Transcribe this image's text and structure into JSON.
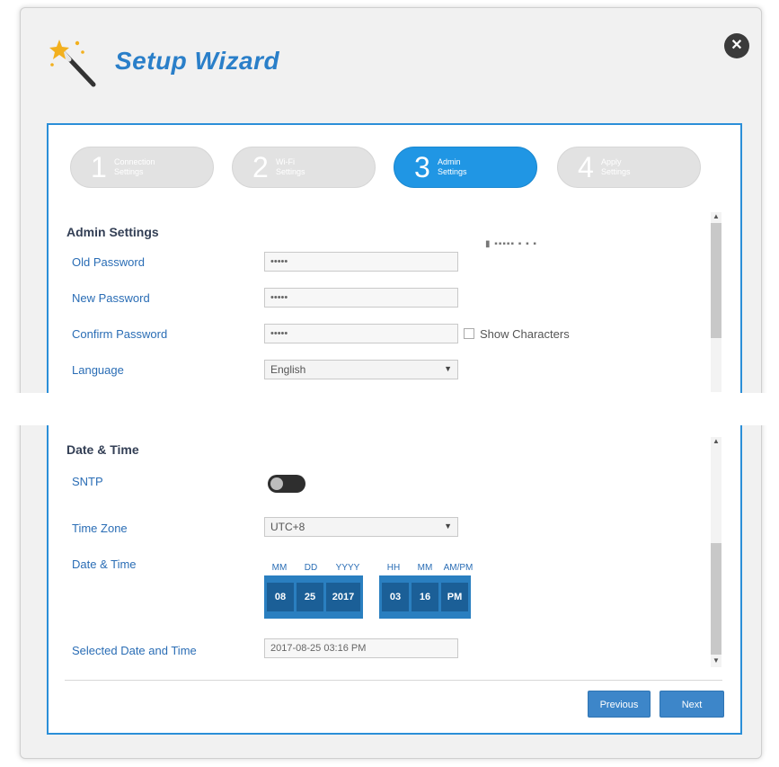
{
  "header": {
    "title": "Setup Wizard"
  },
  "steps": [
    {
      "num": "1",
      "label": "Connection\nSettings"
    },
    {
      "num": "2",
      "label": "Wi-Fi\nSettings"
    },
    {
      "num": "3",
      "label": "Admin\nSettings"
    },
    {
      "num": "4",
      "label": "Apply\nSettings"
    }
  ],
  "admin": {
    "section_title": "Admin Settings",
    "old_password_label": "Old Password",
    "old_password_value": "•••••",
    "new_password_label": "New Password",
    "new_password_value": "•••••",
    "confirm_password_label": "Confirm Password",
    "confirm_password_value": "•••••",
    "show_characters_label": "Show Characters",
    "language_label": "Language",
    "language_value": "English"
  },
  "datetime": {
    "section_title": "Date & Time",
    "sntp_label": "SNTP",
    "timezone_label": "Time Zone",
    "timezone_value": "UTC+8",
    "datetime_label": "Date & Time",
    "headers": [
      "MM",
      "DD",
      "YYYY",
      "HH",
      "MM",
      "AM/PM"
    ],
    "values": [
      "08",
      "25",
      "2017",
      "03",
      "16",
      "PM"
    ],
    "selected_label": "Selected Date and Time",
    "selected_value": "2017-08-25 03:16 PM"
  },
  "footer": {
    "previous_label": "Previous",
    "next_label": "Next"
  },
  "colors": {
    "accent": "#2096e4",
    "panel_border": "#2b8fd8",
    "button": "#3d86c9"
  }
}
